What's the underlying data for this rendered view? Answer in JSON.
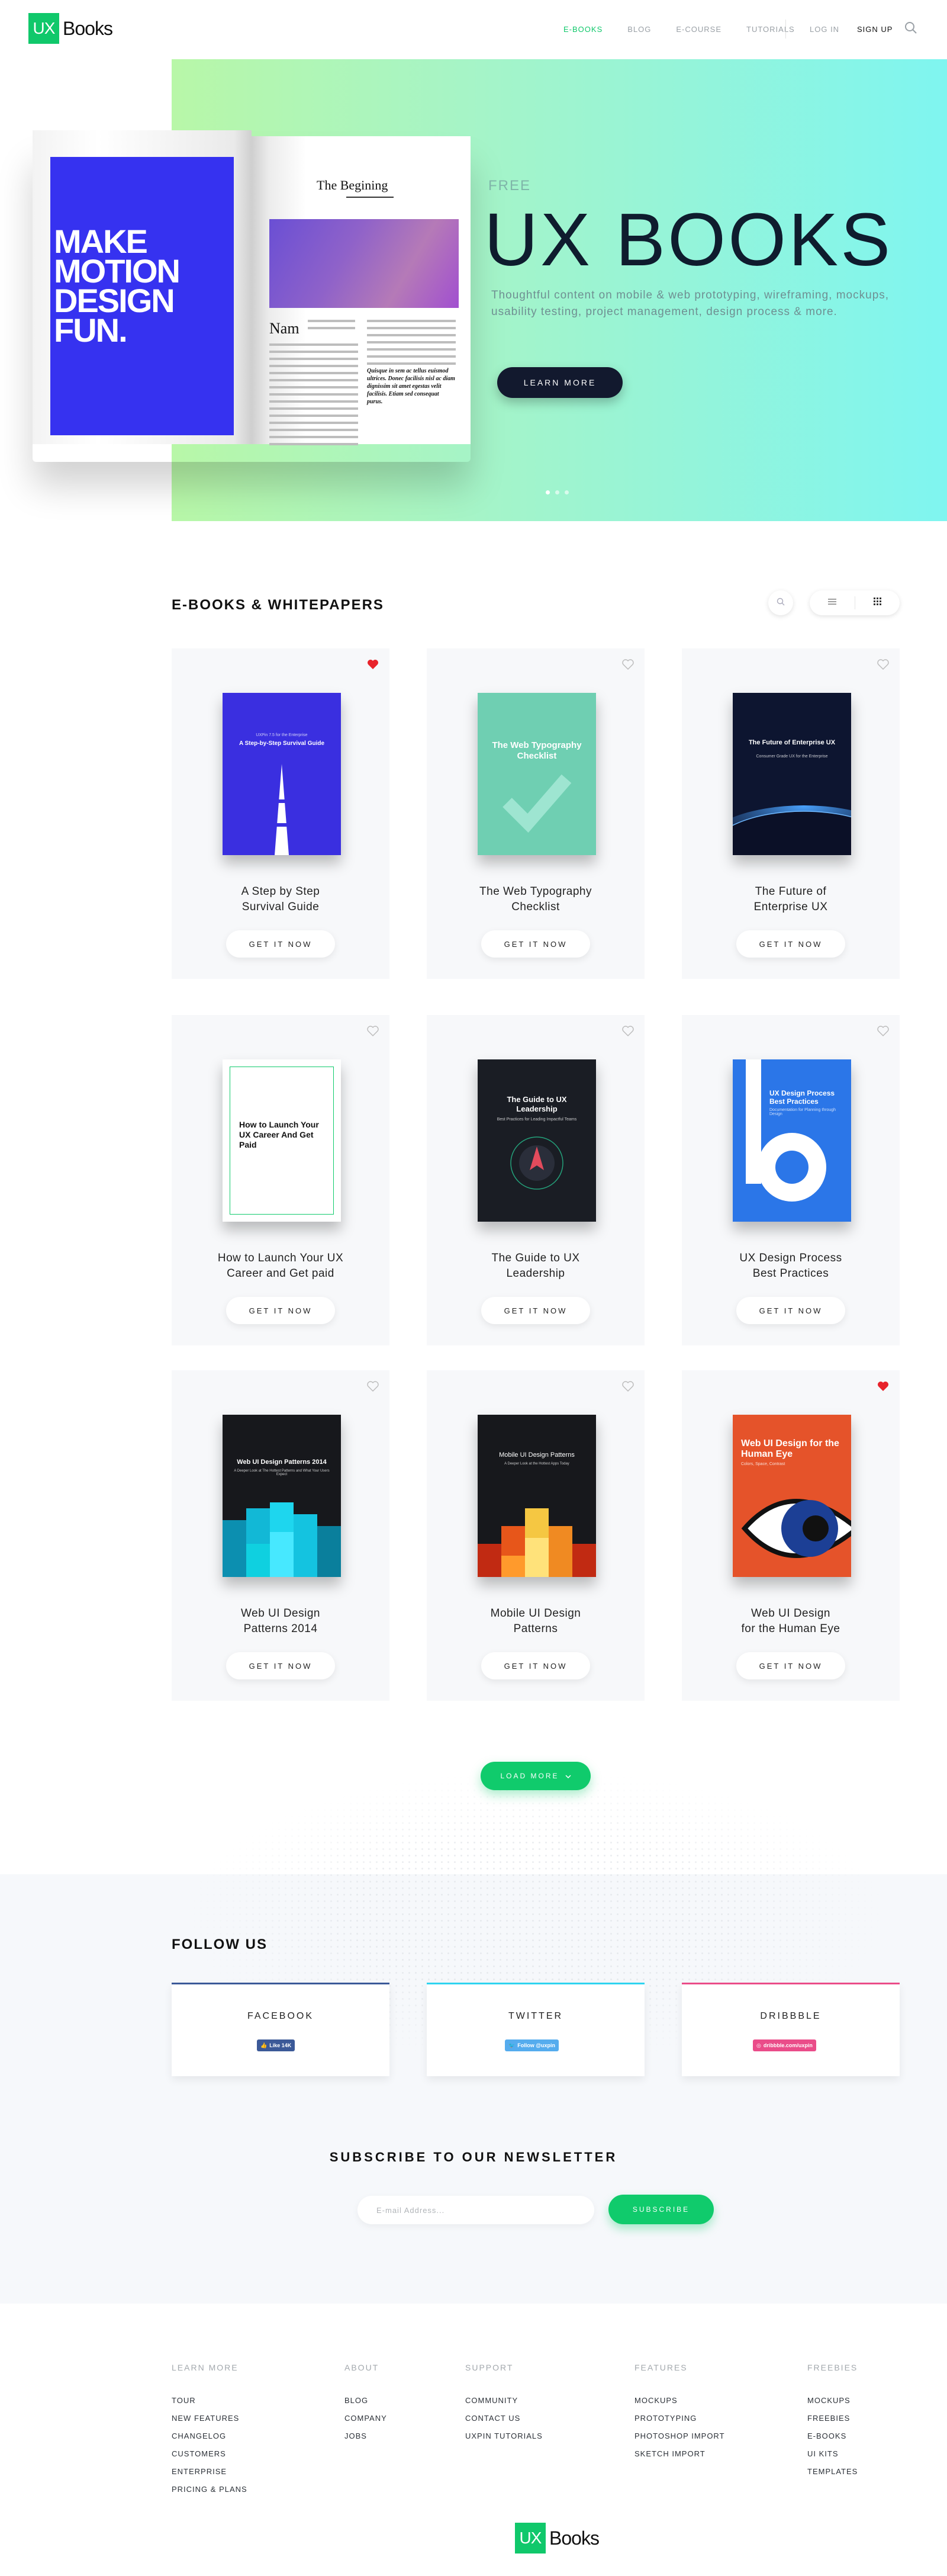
{
  "nav": {
    "logo_box": "UX",
    "logo_text": "Books",
    "links": [
      "E-BOOKS",
      "BLOG",
      "E-COURSE",
      "TUTORIALS"
    ],
    "login": "LOG IN",
    "signup": "SIGN UP"
  },
  "hero": {
    "book_cover_text": [
      "MAKE",
      "MOTION",
      "DESIGN",
      "FUN."
    ],
    "book_page_title": "The Begining",
    "book_page_initial": "Nam",
    "book_page_quote": "Quisque in sem ac tellus euismod ultrices. Donec facilisis nisl ac diam dignissim sit amet egestas velit facilisis. Etiam sed consequat purus.",
    "eyebrow": "FREE",
    "title": "UX BOOKS",
    "description": "Thoughtful content on mobile & web prototyping, wireframing, mockups, usability testing, project management, design process & more.",
    "cta": "LEARN MORE",
    "slides": 3,
    "active_slide": 1
  },
  "section": {
    "title": "E-BOOKS & WHITEPAPERS"
  },
  "cards": [
    {
      "title_lines": [
        "A Step by Step",
        "Survival Guide"
      ],
      "cover_title": "A Step-by-Step Survival Guide",
      "cover_sub": "UXPin 7.5 for the Enterprise",
      "favorite": true,
      "cta": "GET IT NOW"
    },
    {
      "title_lines": [
        "The Web Typography",
        "Checklist"
      ],
      "cover_title": "The Web Typography Checklist",
      "cover_sub": "",
      "favorite": false,
      "cta": "GET IT NOW"
    },
    {
      "title_lines": [
        "The Future of",
        "Enterprise UX"
      ],
      "cover_title": "The Future of Enterprise UX",
      "cover_sub": "Consumer Grade UX for the Enterprise",
      "favorite": false,
      "cta": "GET IT NOW"
    },
    {
      "title_lines": [
        "How to Launch Your UX",
        "Career and Get paid"
      ],
      "cover_title": "How to Launch Your UX Career And Get Paid",
      "cover_sub": "",
      "favorite": false,
      "cta": "GET IT NOW"
    },
    {
      "title_lines": [
        "The Guide to UX",
        "Leadership"
      ],
      "cover_title": "The Guide to UX Leadership",
      "cover_sub": "Best Practices for Leading Impactful Teams",
      "favorite": false,
      "cta": "GET IT NOW"
    },
    {
      "title_lines": [
        "UX Design Process",
        "Best Practices"
      ],
      "cover_title": "UX Design Process Best Practices",
      "cover_sub": "Documentation for Planning through Design",
      "favorite": false,
      "cta": "GET IT NOW"
    },
    {
      "title_lines": [
        "Web UI Design",
        "Patterns 2014"
      ],
      "cover_title": "Web UI Design Patterns 2014",
      "cover_sub": "A Deeper Look at The Hottest Patterns and What Your Users Expect",
      "favorite": false,
      "cta": "GET IT NOW"
    },
    {
      "title_lines": [
        "Mobile UI Design",
        "Patterns"
      ],
      "cover_title": "Mobile UI Design Patterns",
      "cover_sub": "A Deeper Look at the Hottest Apps Today",
      "favorite": false,
      "cta": "GET IT NOW"
    },
    {
      "title_lines": [
        "Web UI Design",
        "for the Human Eye"
      ],
      "cover_title": "Web UI Design for the Human Eye",
      "cover_sub": "Colors, Space, Contrast",
      "favorite": true,
      "cta": "GET IT NOW"
    }
  ],
  "load_more": "LOAD MORE",
  "follow": {
    "title": "FOLLOW US",
    "networks": [
      {
        "name": "FACEBOOK",
        "badge": "Like 14K",
        "color": "#3b5998",
        "bar": "#3b5998"
      },
      {
        "name": "TWITTER",
        "badge": "Follow @uxpin",
        "color": "#55acee",
        "bar": "#2fd4f0"
      },
      {
        "name": "DRIBBBLE",
        "badge": "dribbble.com/uxpin",
        "color": "#ea4c89",
        "bar": "#ea4c89"
      }
    ]
  },
  "newsletter": {
    "title": "SUBSCRIBE TO OUR NEWSLETTER",
    "placeholder": "E-mail Address...",
    "button": "SUBSCRIBE"
  },
  "footer": {
    "columns": [
      {
        "heading": "LEARN MORE",
        "links": [
          "TOUR",
          "NEW FEATURES",
          "CHANGELOG",
          "CUSTOMERS",
          "ENTERPRISE",
          "PRICING & PLANS"
        ]
      },
      {
        "heading": "ABOUT",
        "links": [
          "BLOG",
          "COMPANY",
          "JOBS"
        ]
      },
      {
        "heading": "SUPPORT",
        "links": [
          "COMMUNITY",
          "CONTACT US",
          "UXPIN TUTORIALS"
        ]
      },
      {
        "heading": "FEATURES",
        "links": [
          "MOCKUPS",
          "PROTOTYPING",
          "PHOTOSHOP IMPORT",
          "SKETCH IMPORT"
        ]
      },
      {
        "heading": "FREEBIES",
        "links": [
          "MOCKUPS",
          "FREEBIES",
          "E-BOOKS",
          "UI KITS",
          "TEMPLATES"
        ]
      }
    ],
    "logo_box": "UX",
    "logo_text": "Books"
  },
  "colors": {
    "accent": "#10cb6c",
    "dark": "#12192e",
    "heart": "#e8232b"
  }
}
